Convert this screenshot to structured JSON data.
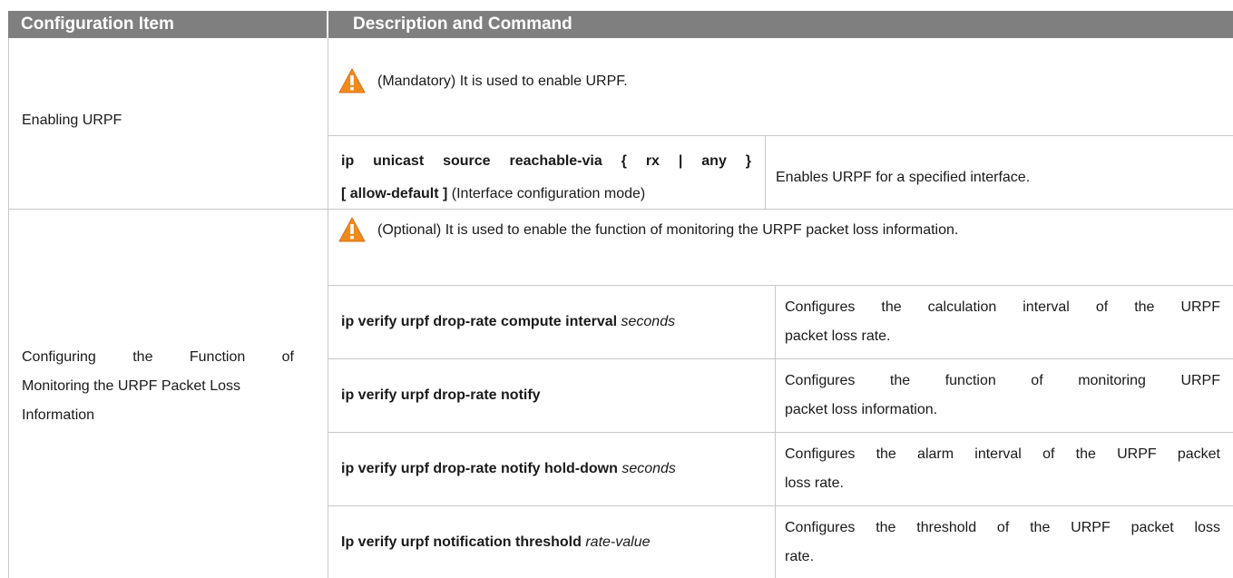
{
  "header": {
    "col1": "Configuration Item",
    "col2": "Description and Command"
  },
  "groups": [
    {
      "item": "Enabling URPF",
      "note": "(Mandatory) It is used to enable URPF.",
      "commands": [
        {
          "line1_a": "ip unicast source reachable-via { rx | any }",
          "line2_bold": "[ allow-default ]",
          "line2_plain": " (Interface configuration mode)",
          "description": "Enables URPF for a specified interface."
        }
      ]
    },
    {
      "item_lines": [
        "Configuring the Function of",
        "Monitoring the URPF Packet Loss",
        "Information"
      ],
      "note": "(Optional) It is used to enable the function of monitoring the URPF packet loss information.",
      "commands": [
        {
          "bold": "ip verify urpf drop-rate compute interval",
          "italic": " seconds",
          "desc1": "Configures the calculation interval of the URPF",
          "desc2": "packet loss rate."
        },
        {
          "bold": "ip verify urpf drop-rate notify",
          "italic": "",
          "desc1": "Configures the function of monitoring URPF",
          "desc2": "packet loss information."
        },
        {
          "bold": "ip verify urpf drop-rate notify hold-down",
          "italic": " seconds",
          "desc1": "Configures the alarm interval of the URPF packet",
          "desc2": "loss rate."
        },
        {
          "bold": "Ip verify urpf notification threshold",
          "italic": " rate-value",
          "desc1": "Configures the threshold of the URPF packet loss",
          "desc2": "rate."
        }
      ]
    }
  ],
  "icons": {
    "warning": "warning-icon",
    "warning_color": "#f08a1c"
  }
}
